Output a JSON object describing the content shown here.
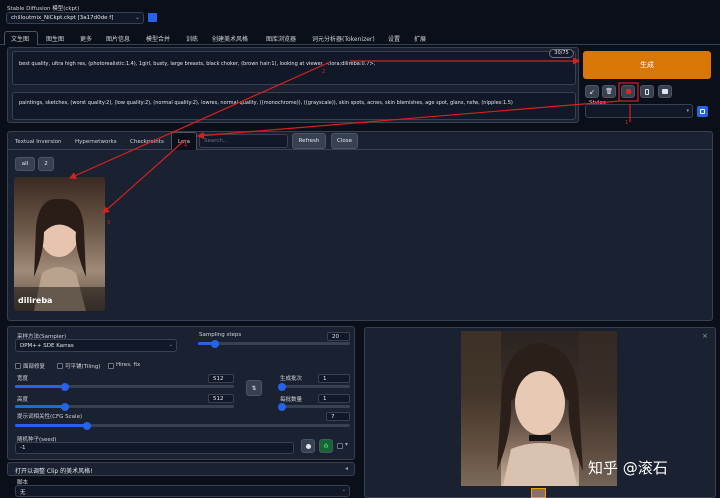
{
  "checkpoint": {
    "label": "Stable Diffusion 模型(ckpt)",
    "value": "chilloutmix_NiCkpt.ckpt [3a17d0de f]"
  },
  "tabs": [
    "文生图",
    "图生图",
    "更多",
    "图片信息",
    "模型合并",
    "训练",
    "创建美术风格",
    "图库浏览器",
    "词元分析器(Tokenizer)",
    "设置",
    "扩展"
  ],
  "prompt": {
    "positive": "best quality, ultra high res, (photorealistic:1.4), 1girl,  busty, large breasts, black choker, (brown hair:1), looking at viewer, <lora:dilireba:0.7>,",
    "negative": "paintings, sketches, (worst quality:2), (low quality:2), (normal quality:2), lowres, normal quality, ((monochrome)), ((grayscale)), skin spots, acnes, skin blemishes, age spot, glans, nsfw, (nipples:1.5)",
    "token_count": "30/75"
  },
  "generate_label": "生成",
  "styles_label": "Styles",
  "tool_icons": [
    "arrow-icon",
    "trash-icon",
    "card-icon",
    "clipboard-icon",
    "save-icon"
  ],
  "extra_tabs": [
    "Textual Inversion",
    "Hypernetworks",
    "Checkpoints",
    "Lora"
  ],
  "search_placeholder": "Search...",
  "refresh_label": "Refresh",
  "close_label": "Close",
  "folder_buttons": [
    "all",
    "2"
  ],
  "lora_card_name": "dilireba",
  "annotations": [
    "2",
    "4",
    "1",
    "3"
  ],
  "params": {
    "sampler_label": "采样方法(Sampler)",
    "sampler_value": "DPM++ SDE Karras",
    "steps_label": "Sampling steps",
    "steps_value": "20",
    "restore_faces": "面部修复",
    "tiling": "可平铺(Tiling)",
    "hires_fix": "Hires. fix",
    "width_label": "宽度",
    "width_value": "512",
    "height_label": "高度",
    "height_value": "512",
    "batch_count_label": "生成批次",
    "batch_count_value": "1",
    "batch_size_label": "每批数量",
    "batch_size_value": "1",
    "cfg_label": "提示词相关性(CFG Scale)",
    "cfg_value": "7",
    "seed_label": "随机种子(seed)",
    "seed_value": "-1",
    "swap_label": "⇅"
  },
  "style_section": {
    "title": "打开以调整 Clip 的美术风格!",
    "script_label": "脚本",
    "script_value": "无"
  },
  "watermark": "知乎 @滚石",
  "colors": {
    "generate": "#d97706",
    "accent": "#2563eb",
    "annotation": "#d92020",
    "background": "#0b0f19",
    "panel": "#1f2937"
  }
}
